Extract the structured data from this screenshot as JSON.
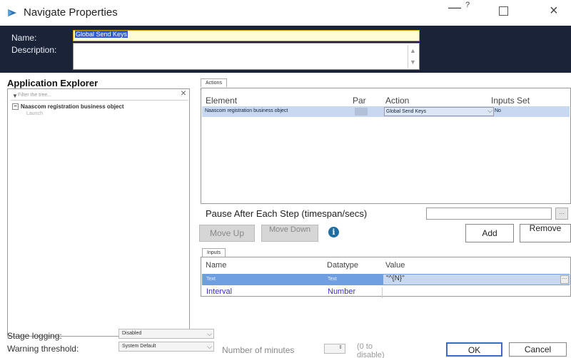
{
  "window": {
    "title": "Navigate Properties",
    "min_symbol": "—",
    "help_symbol": "?",
    "close_symbol": "×"
  },
  "header": {
    "name_label": "Name:",
    "name_value": "Global Send Keys",
    "description_label": "Description:",
    "description_value": ""
  },
  "explorer": {
    "title": "Application Explorer",
    "filter_placeholder": "Filter the tree...",
    "filter_clear": "×",
    "tree": [
      {
        "label": "Naascom registration business object",
        "expanded": true,
        "toggle": "−"
      }
    ],
    "tree_child": "Launch"
  },
  "actions": {
    "tab_label": "Actions",
    "columns": [
      "Element",
      "Par",
      "Action",
      "Inputs Set"
    ],
    "rows": [
      {
        "element": "Naascom registration business object",
        "action": "Global Send Keys",
        "inputs_set": "No"
      }
    ],
    "pause_label": "Pause After Each Step (timespan/secs)",
    "pause_value": "",
    "pause_btn": "⋯",
    "move_up": "Move Up",
    "move_down": "Move Down",
    "info_symbol": "i",
    "add": "Add",
    "remove": "Remove"
  },
  "inputs": {
    "tab_label": "Inputs",
    "columns": [
      "Name",
      "Datatype",
      "Value"
    ],
    "rows": [
      {
        "name": "Text",
        "datatype": "Text",
        "value": "\"^{N}\""
      },
      {
        "name": "Interval",
        "datatype": "Number",
        "value": ""
      }
    ],
    "value_btn": "⋯"
  },
  "footer": {
    "stage_logging_label": "Stage logging:",
    "stage_logging_value": "Disabled",
    "warning_label": "Warning threshold:",
    "warning_value": "System Default",
    "minutes_label": "Number of minutes",
    "minutes_value": "",
    "disable_note": "(0 to disable)",
    "ok": "OK",
    "cancel": "Cancel"
  },
  "colors": {
    "header_bg": "#1b2338",
    "selected_row": "#c8d8f0",
    "input_row": "#6f9fe0",
    "link_text": "#3a2fc9"
  }
}
